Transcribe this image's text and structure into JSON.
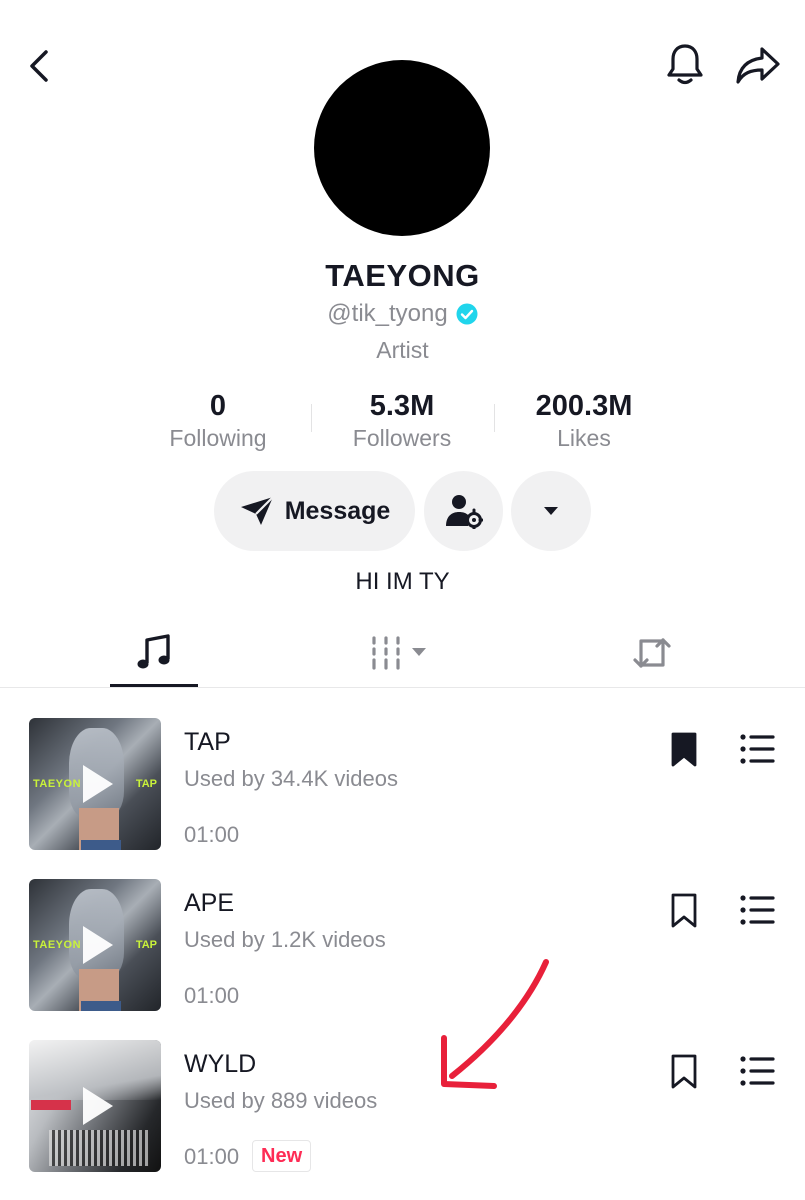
{
  "header": {
    "back_icon": "chevron-left-icon",
    "bell_icon": "bell-icon",
    "share_icon": "share-arrow-icon"
  },
  "profile": {
    "name": "TAEYONG",
    "handle": "@tik_tyong",
    "verified": true,
    "role": "Artist",
    "bio": "HI IM TY"
  },
  "stats": [
    {
      "value": "0",
      "label": "Following"
    },
    {
      "value": "5.3M",
      "label": "Followers"
    },
    {
      "value": "200.3M",
      "label": "Likes"
    }
  ],
  "actions": {
    "message_label": "Message",
    "follow_settings_icon": "person-gear-icon",
    "more_icon": "caret-down-icon"
  },
  "tabs": [
    {
      "icon": "music-note-icon",
      "selected": true
    },
    {
      "icon": "grid-filter-icon",
      "selected": false
    },
    {
      "icon": "repost-icon",
      "selected": false
    }
  ],
  "songs": [
    {
      "title": "TAP",
      "used": "Used by 34.4K videos",
      "duration": "01:00",
      "bookmarked": true,
      "badge": "",
      "cover_left": "TAEYON",
      "cover_right": "TAP"
    },
    {
      "title": "APE",
      "used": "Used by 1.2K videos",
      "duration": "01:00",
      "bookmarked": false,
      "badge": "",
      "cover_left": "TAEYON",
      "cover_right": "TAP"
    },
    {
      "title": "WYLD",
      "used": "Used by 889 videos",
      "duration": "01:00",
      "bookmarked": false,
      "badge": "New"
    }
  ],
  "colors": {
    "text": "#161823",
    "muted": "#8a8b91",
    "pill_bg": "#f1f1f2",
    "verified": "#20d5ec",
    "badge": "#fe2c55",
    "annotation_arrow": "#e8203a"
  }
}
